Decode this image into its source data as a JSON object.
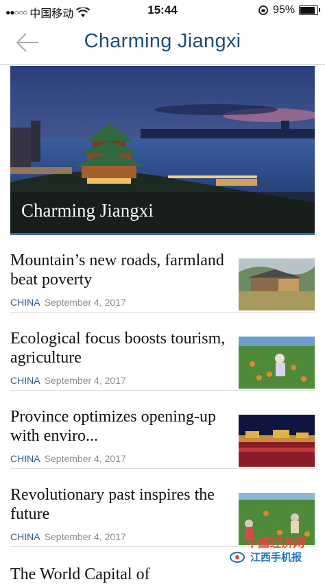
{
  "status_bar": {
    "signal_dots": "●●○○○",
    "carrier": "中国移动",
    "time": "15:44",
    "battery_percent": "95%",
    "battery_level": 0.95
  },
  "nav": {
    "title": "Charming Jiangxi",
    "back_icon": "back-arrow-icon"
  },
  "hero": {
    "caption": "Charming Jiangxi"
  },
  "articles": [
    {
      "headline": "Mountain’s new roads, farmland beat poverty",
      "category": "CHINA",
      "date": "September 4, 2017"
    },
    {
      "headline": "Ecological focus boosts tourism, agriculture",
      "category": "CHINA",
      "date": "September 4, 2017"
    },
    {
      "headline": "Province optimizes opening-up with enviro...",
      "category": "CHINA",
      "date": "September 4, 2017"
    },
    {
      "headline": "Revolutionary past inspires the future",
      "category": "CHINA",
      "date": "September 4, 2017"
    },
    {
      "headline": "The World Capital of"
    }
  ],
  "watermark": {
    "line1": "中国经济网",
    "line2": "江西手机报"
  },
  "colors": {
    "title_blue": "#1d4f78",
    "category_blue": "#2f5a8a",
    "date_gray": "#8c8c8c",
    "accent_border": "#3a6ea5"
  }
}
